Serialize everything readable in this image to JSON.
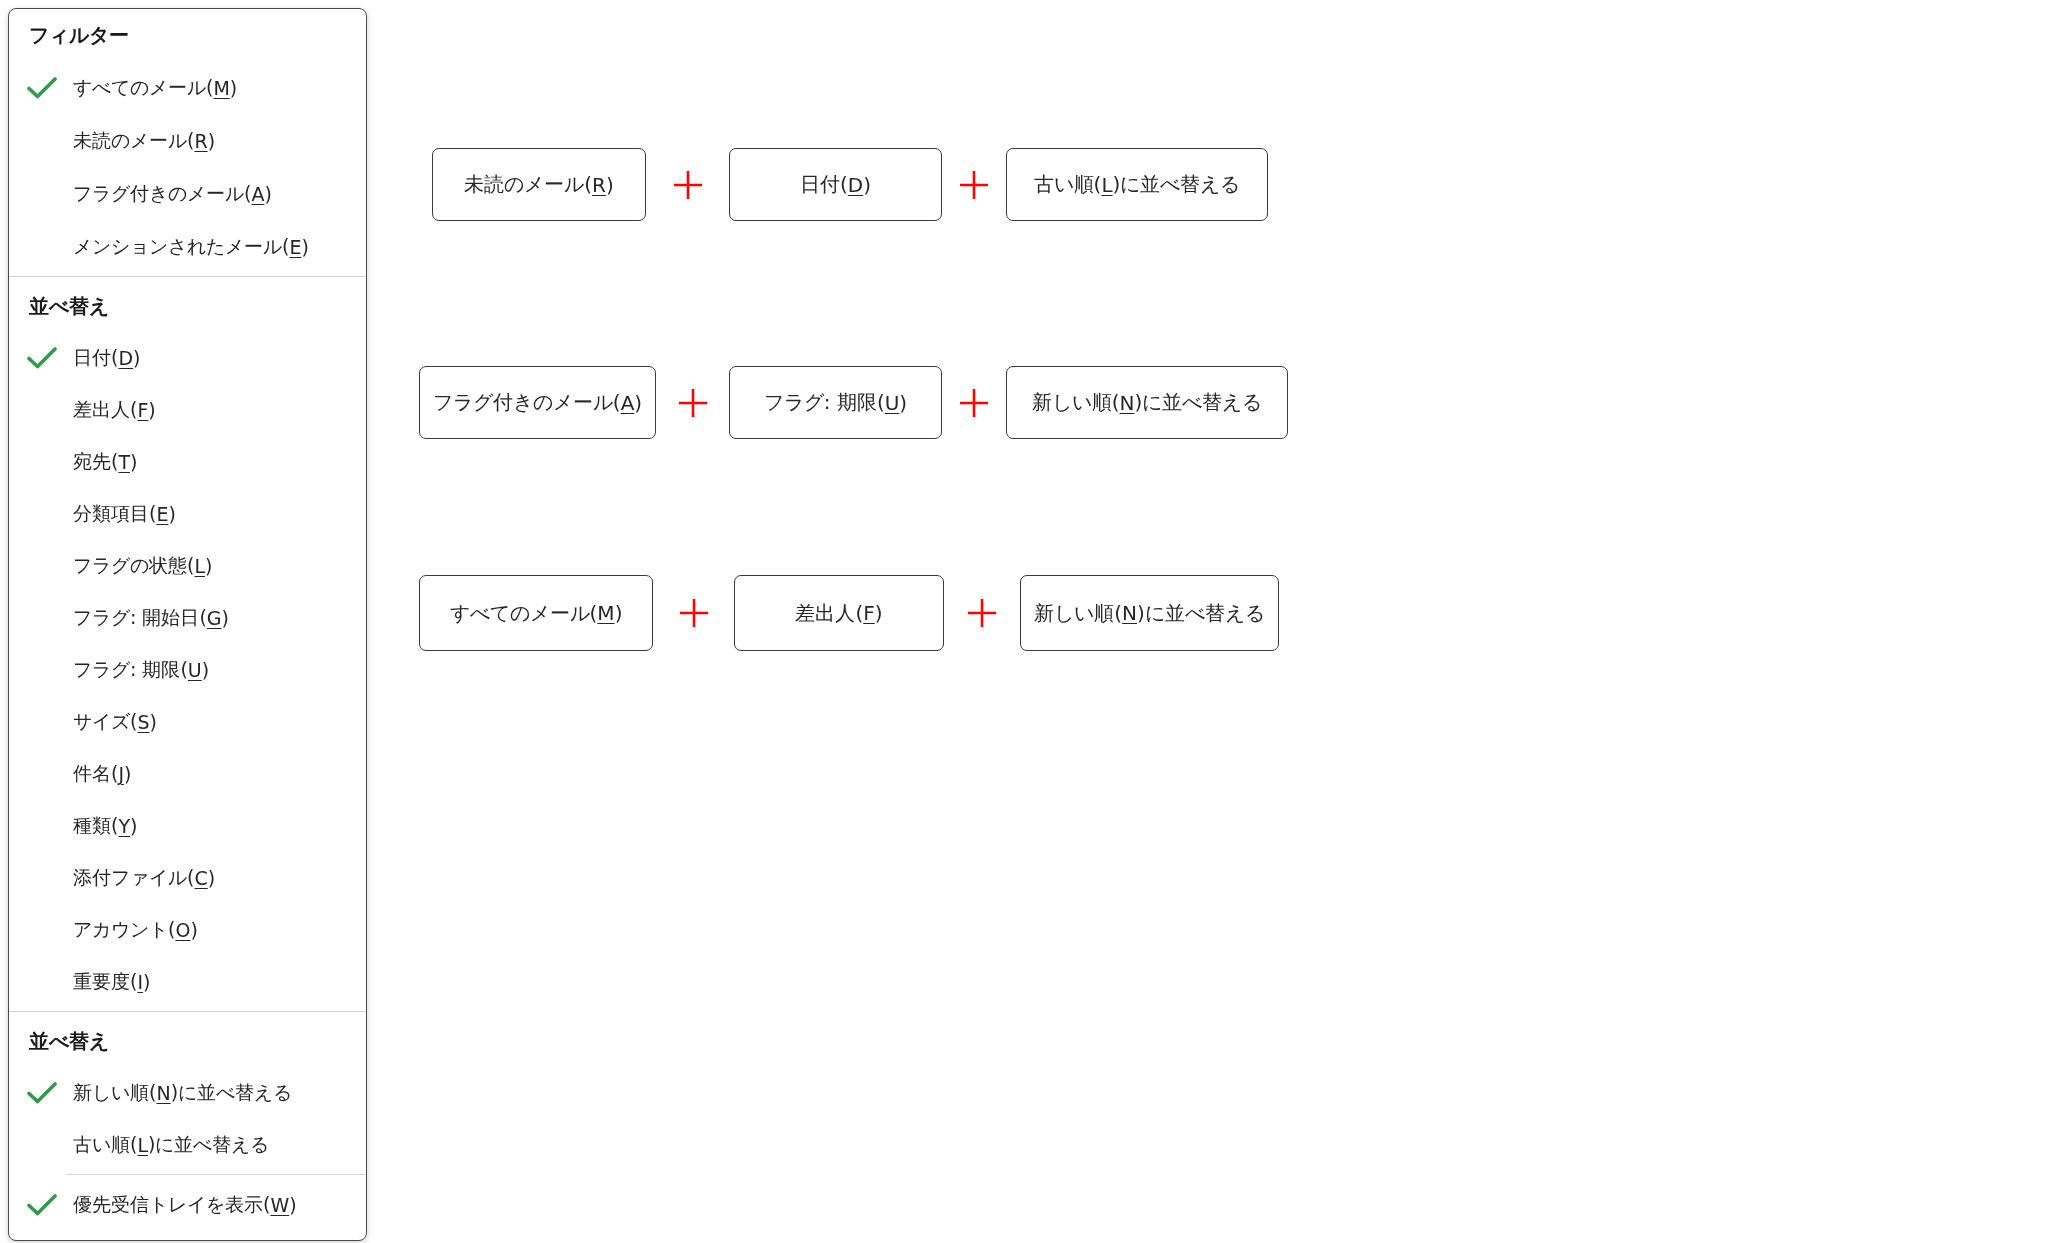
{
  "menu": {
    "sections": [
      {
        "title": "フィルター",
        "items": [
          {
            "label": "すべてのメール(M)",
            "checked": true
          },
          {
            "label": "未読のメール(R)",
            "checked": false
          },
          {
            "label": "フラグ付きのメール(A)",
            "checked": false
          },
          {
            "label": "メンションされたメール(E)",
            "checked": false
          }
        ]
      },
      {
        "title": "並べ替え",
        "items": [
          {
            "label": "日付(D)",
            "checked": true
          },
          {
            "label": "差出人(F)",
            "checked": false
          },
          {
            "label": "宛先(T)",
            "checked": false
          },
          {
            "label": "分類項目(E)",
            "checked": false
          },
          {
            "label": "フラグの状態(L)",
            "checked": false
          },
          {
            "label": "フラグ: 開始日(G)",
            "checked": false
          },
          {
            "label": "フラグ: 期限(U)",
            "checked": false
          },
          {
            "label": "サイズ(S)",
            "checked": false
          },
          {
            "label": "件名(J)",
            "checked": false
          },
          {
            "label": "種類(Y)",
            "checked": false
          },
          {
            "label": "添付ファイル(C)",
            "checked": false
          },
          {
            "label": "アカウント(O)",
            "checked": false
          },
          {
            "label": "重要度(I)",
            "checked": false
          }
        ]
      },
      {
        "title": "並べ替え",
        "items": [
          {
            "label": "新しい順(N)に並べ替える",
            "checked": true
          },
          {
            "label": "古い順(L)に並べ替える",
            "checked": false
          }
        ]
      }
    ],
    "toggle_item": {
      "label": "優先受信トレイを表示(W)",
      "checked": true
    }
  },
  "combinations": [
    {
      "parts": [
        {
          "label": "未読のメール(R)"
        },
        {
          "label": "日付(D)"
        },
        {
          "label": "古い順(L)に並べ替える"
        }
      ]
    },
    {
      "parts": [
        {
          "label": "フラグ付きのメール(A)"
        },
        {
          "label": "フラグ: 期限(U)"
        },
        {
          "label": "新しい順(N)に並べ替える"
        }
      ]
    },
    {
      "parts": [
        {
          "label": "すべてのメール(M)"
        },
        {
          "label": "差出人(F)"
        },
        {
          "label": "新しい順(N)に並べ替える"
        }
      ]
    }
  ]
}
